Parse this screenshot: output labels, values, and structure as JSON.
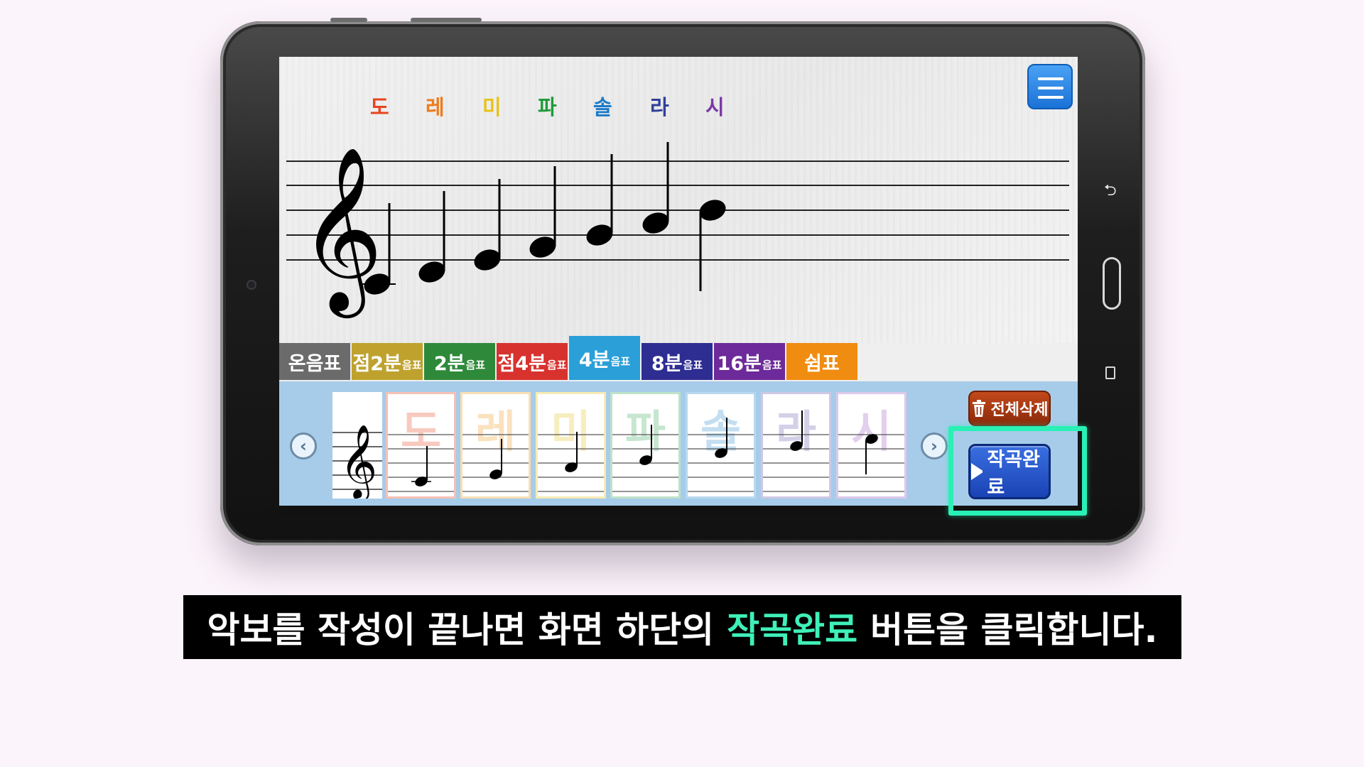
{
  "solfege": [
    {
      "label": "도",
      "color": "#e8431e"
    },
    {
      "label": "레",
      "color": "#ef7b1b"
    },
    {
      "label": "미",
      "color": "#e8c21a"
    },
    {
      "label": "파",
      "color": "#1f9b3a"
    },
    {
      "label": "솔",
      "color": "#1b7ac9"
    },
    {
      "label": "라",
      "color": "#2f3f9a"
    },
    {
      "label": "시",
      "color": "#7b3aa6"
    }
  ],
  "tabs": [
    {
      "label": "온음표",
      "suffix": "",
      "color": "#6b6b6b",
      "selected": false
    },
    {
      "label": "점2분",
      "suffix": "음표",
      "color": "#bfa22e",
      "selected": false
    },
    {
      "label": "2분",
      "suffix": "음표",
      "color": "#2e8a3a",
      "selected": false
    },
    {
      "label": "점4분",
      "suffix": "음표",
      "color": "#d8322f",
      "selected": false
    },
    {
      "label": "4분",
      "suffix": "음표",
      "color": "#2a9fd8",
      "selected": true
    },
    {
      "label": "8분",
      "suffix": "음표",
      "color": "#2e2d92",
      "selected": false
    },
    {
      "label": "16분",
      "suffix": "음표",
      "color": "#6d2a9a",
      "selected": false
    },
    {
      "label": "쉼표",
      "suffix": "",
      "color": "#f08c10",
      "selected": false
    }
  ],
  "palette_cards": [
    {
      "ghost": "도",
      "color": "#e8431e"
    },
    {
      "ghost": "레",
      "color": "#ef9b1b"
    },
    {
      "ghost": "미",
      "color": "#e8c21a"
    },
    {
      "ghost": "파",
      "color": "#3aa85a"
    },
    {
      "ghost": "솔",
      "color": "#2b8ad0"
    },
    {
      "ghost": "라",
      "color": "#6a5ab0"
    },
    {
      "ghost": "시",
      "color": "#9a5ac0"
    }
  ],
  "buttons": {
    "delete_all": "전체삭제",
    "complete": "작곡완료"
  },
  "icons": {
    "menu": "hamburger-menu-icon",
    "prev": "chevron-left-icon",
    "next": "chevron-right-icon",
    "delete": "trash-icon",
    "play": "play-triangle-icon"
  },
  "caption": {
    "before": "악보를 작성이 끝나면 화면 하단의",
    "highlight": "작곡완료",
    "after": "버튼을 클릭합니다."
  },
  "colors": {
    "highlight_box": "#29f0b4",
    "caption_highlight": "#3ff0b8",
    "palette_bg": "#a6ccea",
    "complete_button": "#1a43b5",
    "delete_button": "#8b2a0a"
  }
}
